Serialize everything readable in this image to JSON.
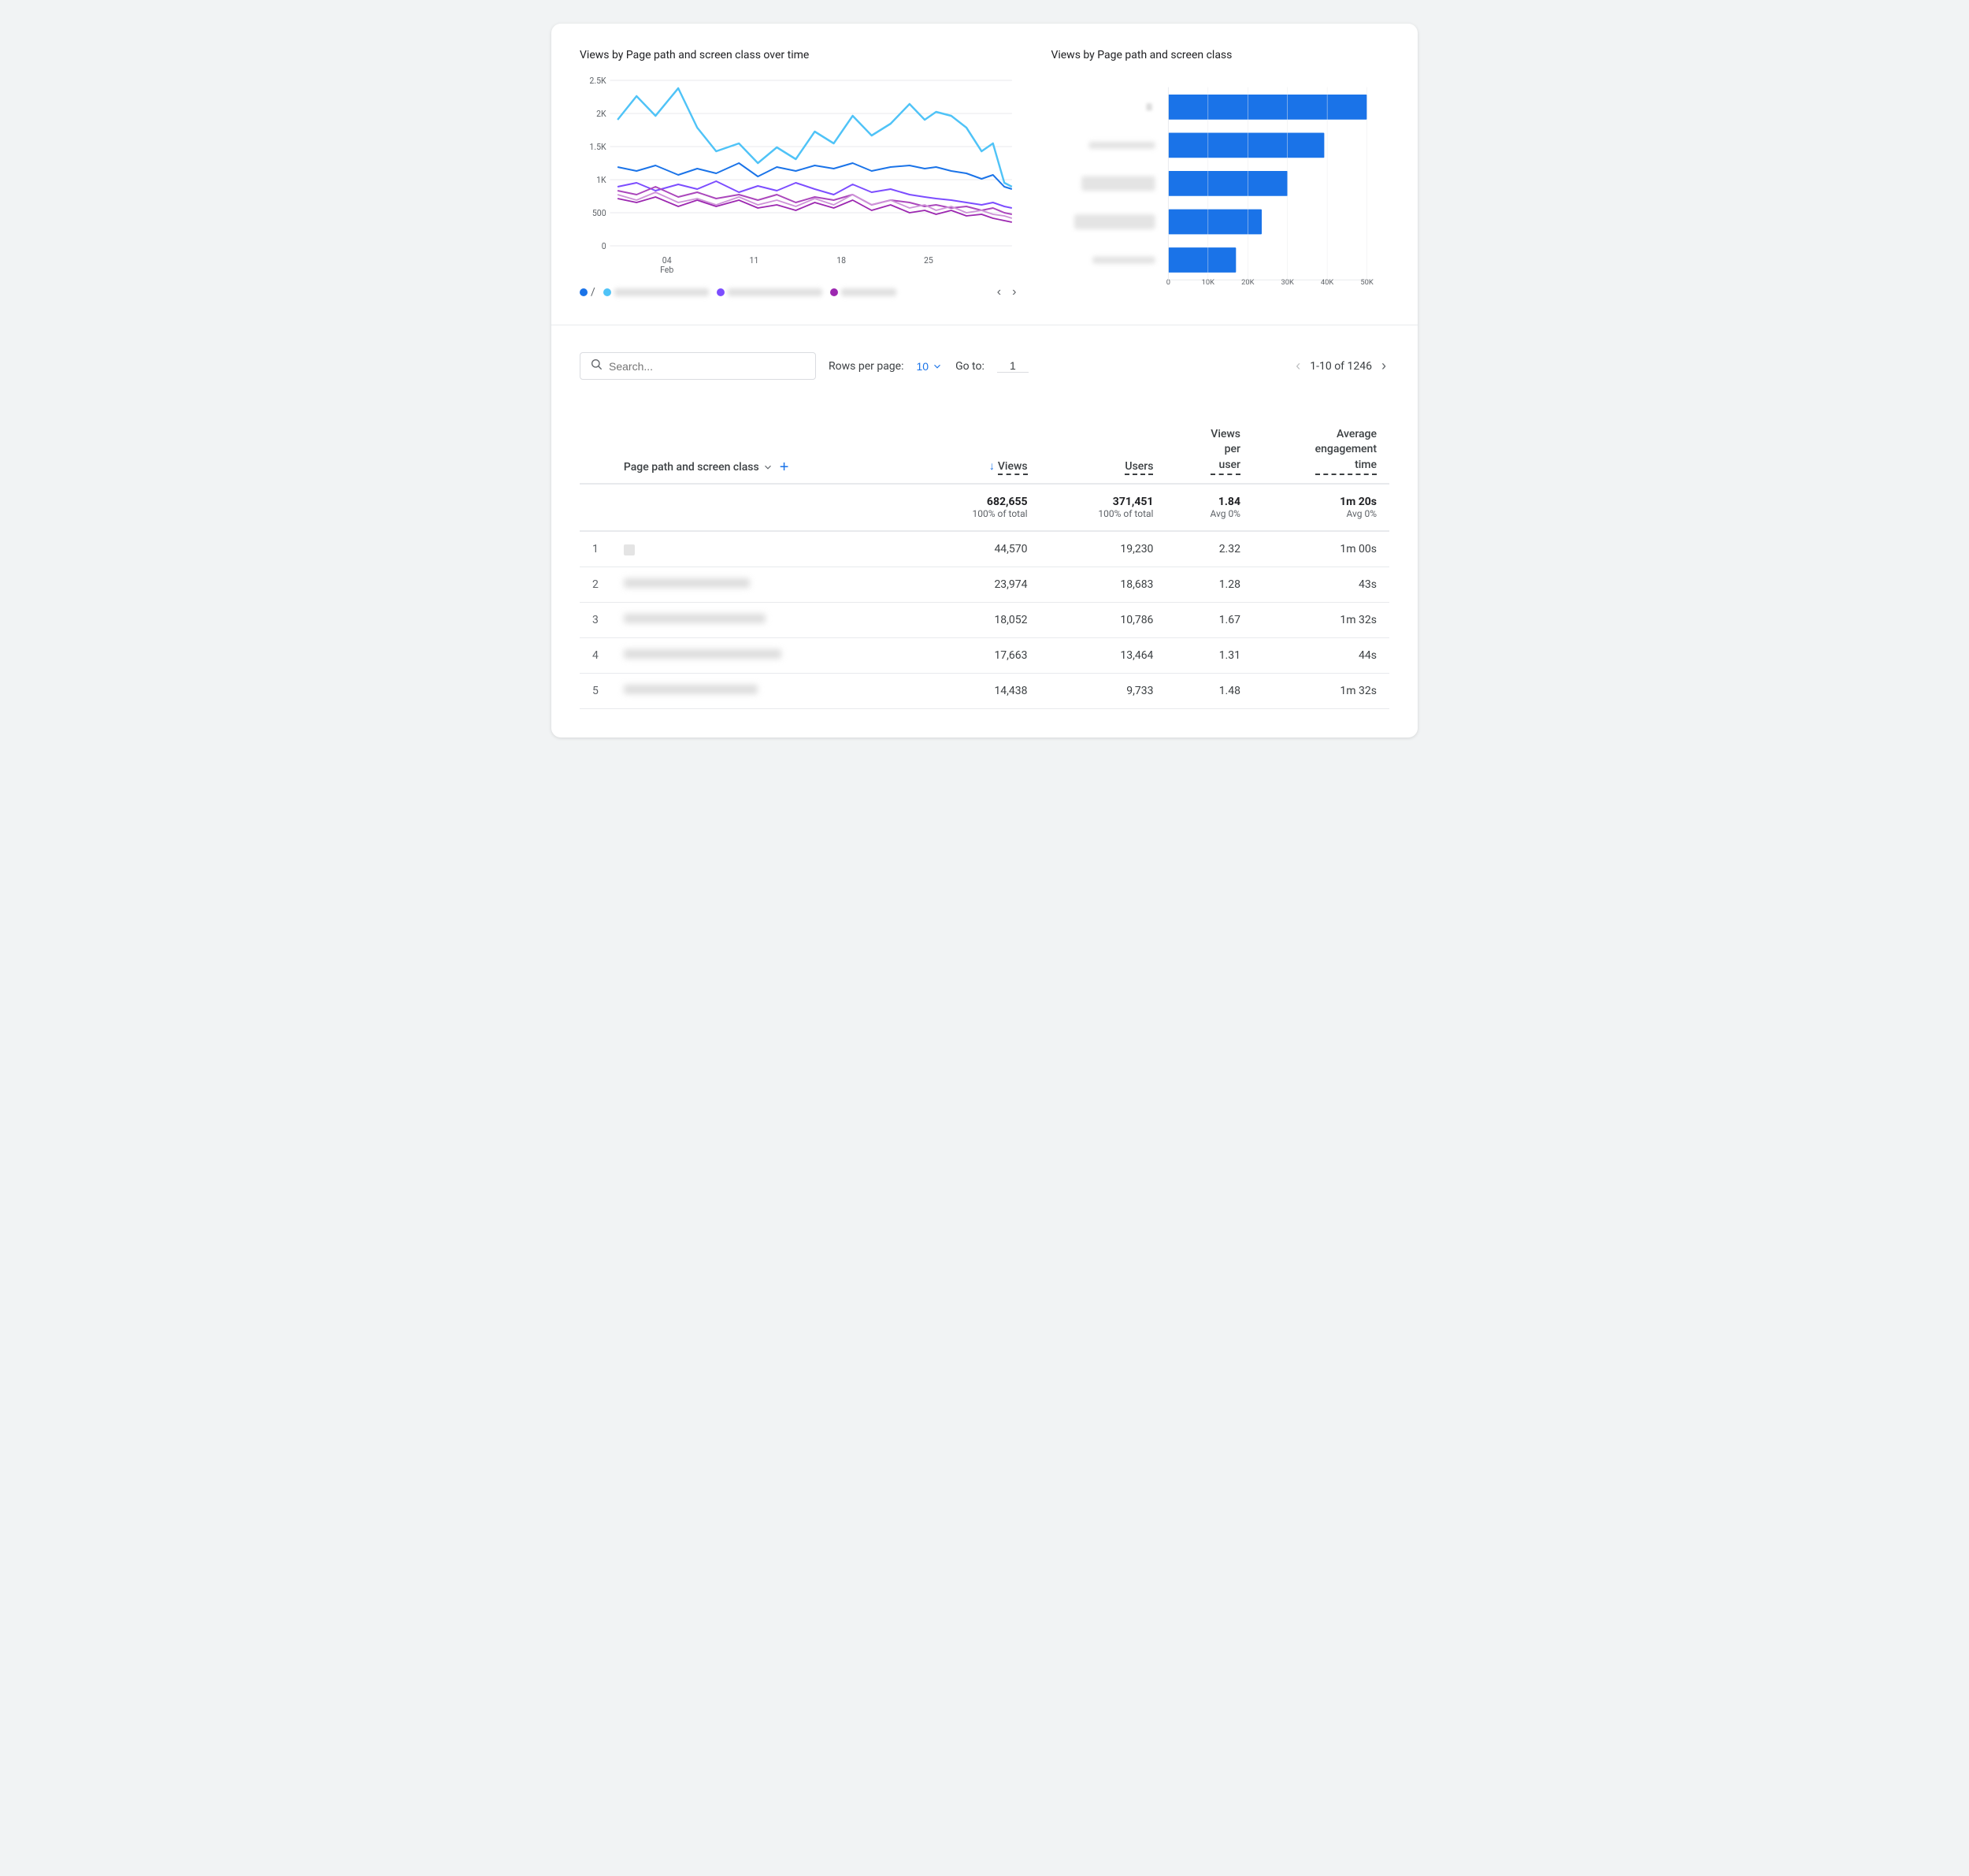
{
  "chartLeft": {
    "title": "Views by Page path and screen class over time",
    "xLabels": [
      "04\nFeb",
      "11",
      "18",
      "25"
    ],
    "yLabels": [
      "2.5K",
      "2K",
      "1.5K",
      "1K",
      "500",
      "0"
    ],
    "legend": [
      {
        "id": "slash",
        "type": "dot",
        "color": "#1a73e8",
        "label": "/"
      },
      {
        "id": "l1",
        "type": "blurred",
        "color": "#4fc3f7"
      },
      {
        "id": "l2",
        "type": "dot",
        "color": "#7c4dff"
      },
      {
        "id": "l3",
        "type": "blurred",
        "color": "#ab47bc"
      },
      {
        "id": "l4",
        "type": "dot",
        "color": "#9c27b0"
      },
      {
        "id": "l5",
        "type": "blurred-sm",
        "color": "#9c27b0"
      }
    ]
  },
  "chartRight": {
    "title": "Views by Page path and screen class",
    "xLabels": [
      "0",
      "10K",
      "20K",
      "30K",
      "40K",
      "50K"
    ],
    "bars": [
      {
        "label": "",
        "blurred": false,
        "value": 49000,
        "max": 50000
      },
      {
        "label": "",
        "blurred": true,
        "value": 37000,
        "max": 50000
      },
      {
        "label": "",
        "blurred": true,
        "value": 28000,
        "max": 50000
      },
      {
        "label": "",
        "blurred": true,
        "value": 22000,
        "max": 50000
      },
      {
        "label": "",
        "blurred": true,
        "value": 16000,
        "max": 50000
      }
    ]
  },
  "toolbar": {
    "searchPlaceholder": "Search...",
    "rowsLabel": "Rows per page:",
    "rowsValue": "10",
    "gotoLabel": "Go to:",
    "gotoValue": "1",
    "paginationText": "1-10 of 1246"
  },
  "table": {
    "columns": [
      {
        "id": "num",
        "label": ""
      },
      {
        "id": "page",
        "label": "Page path and screen class"
      },
      {
        "id": "views",
        "label": "Views",
        "sorted": true
      },
      {
        "id": "users",
        "label": "Users"
      },
      {
        "id": "vpu",
        "label": "Views\nper\nuser"
      },
      {
        "id": "aet",
        "label": "Average\nengagement\ntime"
      }
    ],
    "totals": {
      "views": "682,655",
      "viewsSub": "100% of total",
      "users": "371,451",
      "usersSub": "100% of total",
      "vpu": "1.84",
      "vpuSub": "Avg 0%",
      "aet": "1m 20s",
      "aetSub": "Avg 0%"
    },
    "rows": [
      {
        "num": "1",
        "page": "/",
        "pageBlurred": false,
        "views": "44,570",
        "users": "19,230",
        "vpu": "2.32",
        "aet": "1m 00s"
      },
      {
        "num": "2",
        "page": "",
        "pageBlurred": true,
        "pageWidth": 160,
        "views": "23,974",
        "users": "18,683",
        "vpu": "1.28",
        "aet": "43s"
      },
      {
        "num": "3",
        "page": "",
        "pageBlurred": true,
        "pageWidth": 180,
        "views": "18,052",
        "users": "10,786",
        "vpu": "1.67",
        "aet": "1m 32s"
      },
      {
        "num": "4",
        "page": "",
        "pageBlurred": true,
        "pageWidth": 200,
        "views": "17,663",
        "users": "13,464",
        "vpu": "1.31",
        "aet": "44s"
      },
      {
        "num": "5",
        "page": "",
        "pageBlurred": true,
        "pageWidth": 170,
        "views": "14,438",
        "users": "9,733",
        "vpu": "1.48",
        "aet": "1m 32s"
      }
    ]
  }
}
